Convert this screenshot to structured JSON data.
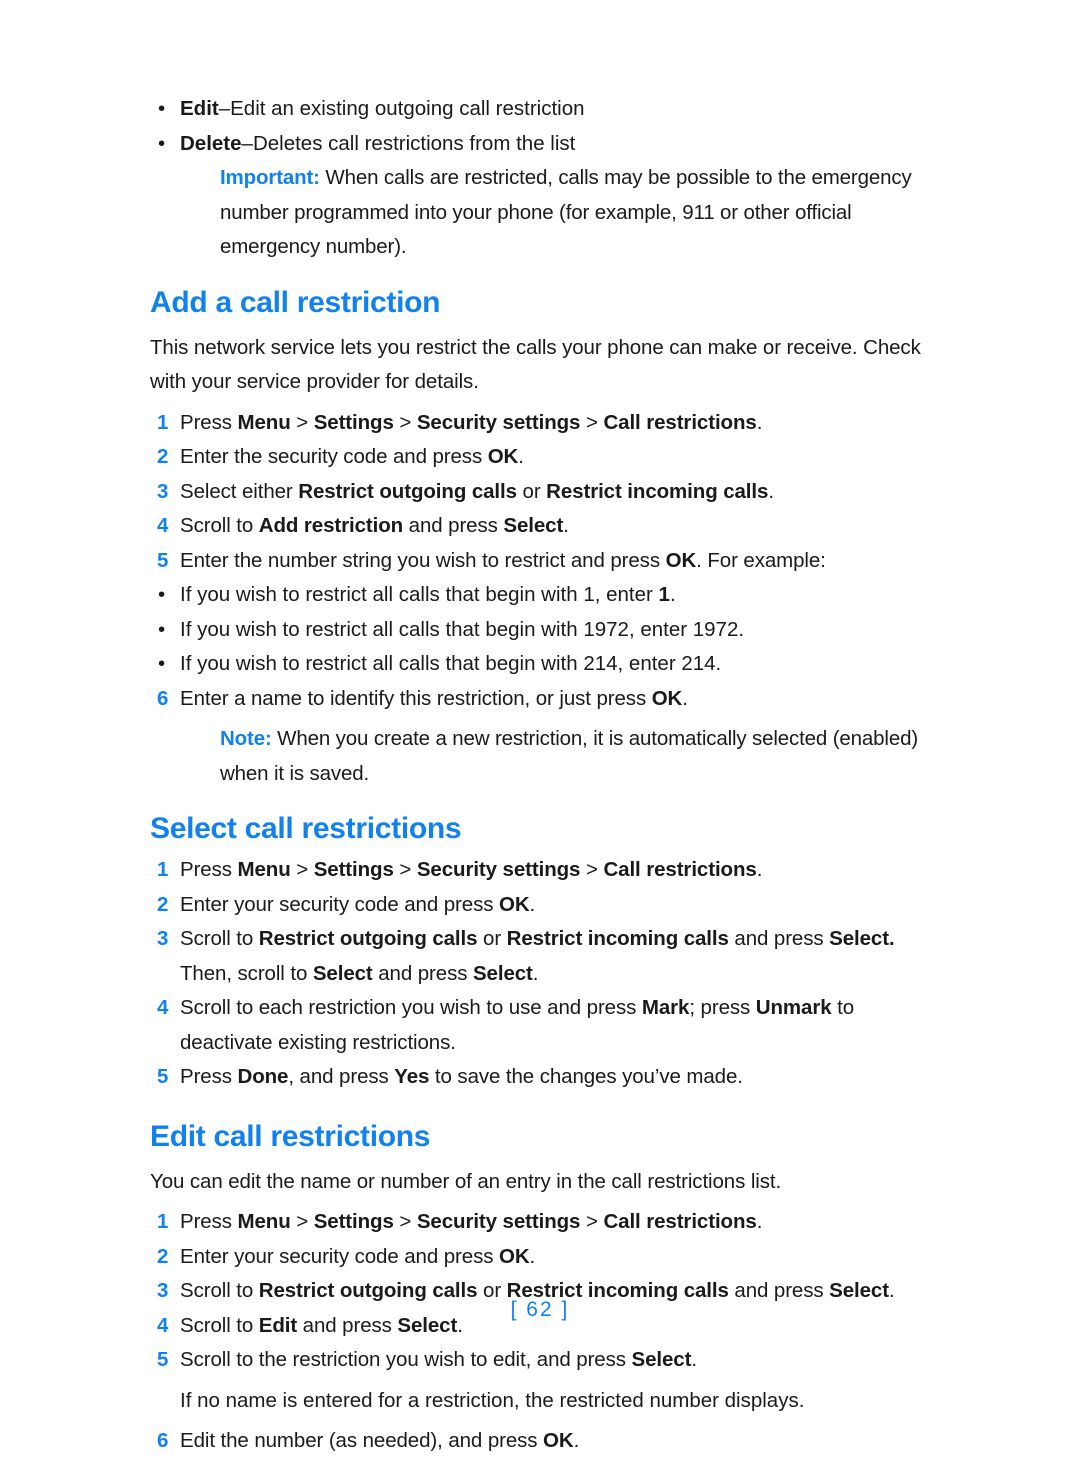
{
  "page": {
    "number_label": "[ 62 ]",
    "accent_color": "#1281f0",
    "text_color": "#1a1a1a",
    "background_color": "#ffffff"
  },
  "intro_bullets": [
    {
      "term": "Edit",
      "dash": "–",
      "rest": "Edit an existing outgoing call restriction",
      "marker": "•"
    },
    {
      "term": "Delete",
      "dash": "–",
      "rest": "Deletes call restrictions from the list",
      "marker": "•"
    }
  ],
  "important_note": {
    "label": "Important:",
    "text": " When calls are restricted, calls may be possible to the emergency number programmed into your phone (for example, 911 or other official emergency number)."
  },
  "sections": [
    {
      "heading": "Add a call restriction",
      "intro": "This network service lets you restrict the calls your phone can make or receive. Check with your service provider for details.",
      "steps": [
        {
          "num": "1",
          "parts": [
            {
              "t": "Press ",
              "b": false
            },
            {
              "t": "Menu",
              "b": true
            },
            {
              "t": " > ",
              "b": false
            },
            {
              "t": "Settings",
              "b": true
            },
            {
              "t": " > ",
              "b": false
            },
            {
              "t": "Security settings",
              "b": true
            },
            {
              "t": " > ",
              "b": false
            },
            {
              "t": "Call restrictions",
              "b": true
            },
            {
              "t": ".",
              "b": false
            }
          ]
        },
        {
          "num": "2",
          "parts": [
            {
              "t": "Enter the security code and press ",
              "b": false
            },
            {
              "t": "OK",
              "b": true
            },
            {
              "t": ".",
              "b": false
            }
          ]
        },
        {
          "num": "3",
          "parts": [
            {
              "t": "Select either ",
              "b": false
            },
            {
              "t": "Restrict outgoing calls",
              "b": true
            },
            {
              "t": " or ",
              "b": false
            },
            {
              "t": "Restrict incoming calls",
              "b": true
            },
            {
              "t": ".",
              "b": false
            }
          ]
        },
        {
          "num": "4",
          "parts": [
            {
              "t": "Scroll to ",
              "b": false
            },
            {
              "t": "Add restriction",
              "b": true
            },
            {
              "t": " and press ",
              "b": false
            },
            {
              "t": "Select",
              "b": true
            },
            {
              "t": ".",
              "b": false
            }
          ]
        },
        {
          "num": "5",
          "parts": [
            {
              "t": "Enter the number string you wish to restrict and press ",
              "b": false
            },
            {
              "t": "OK",
              "b": true
            },
            {
              "t": ". For example:",
              "b": false
            }
          ]
        }
      ],
      "example_bullets": [
        {
          "marker": "•",
          "parts": [
            {
              "t": "If you wish to restrict all calls that begin with 1, enter ",
              "b": false
            },
            {
              "t": "1",
              "b": true
            },
            {
              "t": ".",
              "b": false
            }
          ]
        },
        {
          "marker": "•",
          "parts": [
            {
              "t": "If you wish to restrict all calls that begin with 1972, enter 1972.",
              "b": false
            }
          ]
        },
        {
          "marker": "•",
          "parts": [
            {
              "t": "If you wish to restrict all calls that begin with 214, enter 214.",
              "b": false
            }
          ]
        }
      ],
      "steps_after": [
        {
          "num": "6",
          "parts": [
            {
              "t": "Enter a name to identify this restriction, or just press ",
              "b": false
            },
            {
              "t": "OK",
              "b": true
            },
            {
              "t": ".",
              "b": false
            }
          ]
        }
      ],
      "note": {
        "label": "Note:",
        "text": " When you create a new restriction, it is automatically selected (enabled) when it is saved."
      }
    },
    {
      "heading": "Select call restrictions",
      "steps": [
        {
          "num": "1",
          "parts": [
            {
              "t": "Press ",
              "b": false
            },
            {
              "t": "Menu",
              "b": true
            },
            {
              "t": " > ",
              "b": false
            },
            {
              "t": "Settings",
              "b": true
            },
            {
              "t": " > ",
              "b": false
            },
            {
              "t": "Security settings",
              "b": true
            },
            {
              "t": " > ",
              "b": false
            },
            {
              "t": "Call restrictions",
              "b": true
            },
            {
              "t": ".",
              "b": false
            }
          ]
        },
        {
          "num": "2",
          "parts": [
            {
              "t": "Enter your security code and press ",
              "b": false
            },
            {
              "t": "OK",
              "b": true
            },
            {
              "t": ".",
              "b": false
            }
          ]
        },
        {
          "num": "3",
          "parts": [
            {
              "t": "Scroll to ",
              "b": false
            },
            {
              "t": "Restrict outgoing calls",
              "b": true
            },
            {
              "t": " or ",
              "b": false
            },
            {
              "t": "Restrict incoming calls",
              "b": true
            },
            {
              "t": " and press ",
              "b": false
            },
            {
              "t": "Select.",
              "b": true
            },
            {
              "t": " Then, scroll to ",
              "b": false
            },
            {
              "t": "Select",
              "b": true
            },
            {
              "t": " and press ",
              "b": false
            },
            {
              "t": "Select",
              "b": true
            },
            {
              "t": ".",
              "b": false
            }
          ]
        },
        {
          "num": "4",
          "parts": [
            {
              "t": "Scroll to each restriction you wish to use and press ",
              "b": false
            },
            {
              "t": "Mark",
              "b": true
            },
            {
              "t": "; press ",
              "b": false
            },
            {
              "t": "Unmark",
              "b": true
            },
            {
              "t": " to deactivate existing restrictions.",
              "b": false
            }
          ]
        },
        {
          "num": "5",
          "parts": [
            {
              "t": "Press ",
              "b": false
            },
            {
              "t": "Done",
              "b": true
            },
            {
              "t": ", and press ",
              "b": false
            },
            {
              "t": "Yes",
              "b": true
            },
            {
              "t": " to save the changes you’ve made.",
              "b": false
            }
          ]
        }
      ]
    },
    {
      "heading": "Edit call restrictions",
      "intro": "You can edit the name or number of an entry in the call restrictions list.",
      "steps": [
        {
          "num": "1",
          "parts": [
            {
              "t": "Press ",
              "b": false
            },
            {
              "t": "Menu",
              "b": true
            },
            {
              "t": " > ",
              "b": false
            },
            {
              "t": "Settings",
              "b": true
            },
            {
              "t": " > ",
              "b": false
            },
            {
              "t": "Security settings",
              "b": true
            },
            {
              "t": " > ",
              "b": false
            },
            {
              "t": "Call restrictions",
              "b": true
            },
            {
              "t": ".",
              "b": false
            }
          ]
        },
        {
          "num": "2",
          "parts": [
            {
              "t": "Enter your security code and press ",
              "b": false
            },
            {
              "t": "OK",
              "b": true
            },
            {
              "t": ".",
              "b": false
            }
          ]
        },
        {
          "num": "3",
          "parts": [
            {
              "t": "Scroll to ",
              "b": false
            },
            {
              "t": "Restrict outgoing calls",
              "b": true
            },
            {
              "t": " or ",
              "b": false
            },
            {
              "t": "Restrict incoming calls",
              "b": true
            },
            {
              "t": " and press ",
              "b": false
            },
            {
              "t": "Select",
              "b": true
            },
            {
              "t": ".",
              "b": false
            }
          ]
        },
        {
          "num": "4",
          "parts": [
            {
              "t": "Scroll to ",
              "b": false
            },
            {
              "t": "Edit",
              "b": true
            },
            {
              "t": " and press ",
              "b": false
            },
            {
              "t": "Select",
              "b": true
            },
            {
              "t": ".",
              "b": false
            }
          ]
        },
        {
          "num": "5",
          "parts": [
            {
              "t": "Scroll to the restriction you wish to edit, and press ",
              "b": false
            },
            {
              "t": "Select",
              "b": true
            },
            {
              "t": ".",
              "b": false
            }
          ]
        }
      ],
      "continuation": "If no name is entered for a restriction, the restricted number displays.",
      "steps_after": [
        {
          "num": "6",
          "parts": [
            {
              "t": "Edit the number (as needed), and press ",
              "b": false
            },
            {
              "t": "OK",
              "b": true
            },
            {
              "t": ".",
              "b": false
            }
          ]
        }
      ]
    }
  ]
}
